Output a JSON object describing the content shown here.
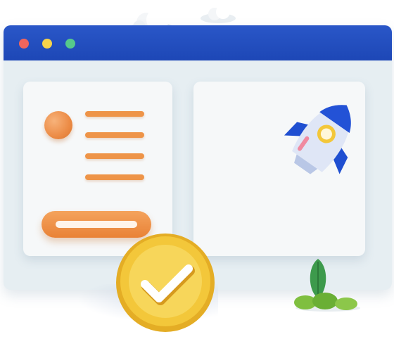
{
  "window": {
    "controls": [
      "close",
      "minimize",
      "maximize"
    ],
    "colors": {
      "titlebar": "#1d47b6",
      "close": "#f0655c",
      "minimize": "#f6d34a",
      "maximize": "#56c98b",
      "accent": "#ee9448",
      "coin": "#f3c73a",
      "rocket": "#1f4fd1",
      "plant": "#3d9a4c"
    }
  },
  "icons": [
    "cloud-icon",
    "rocket-icon",
    "check-coin-icon",
    "plant-icon",
    "avatar-icon"
  ]
}
